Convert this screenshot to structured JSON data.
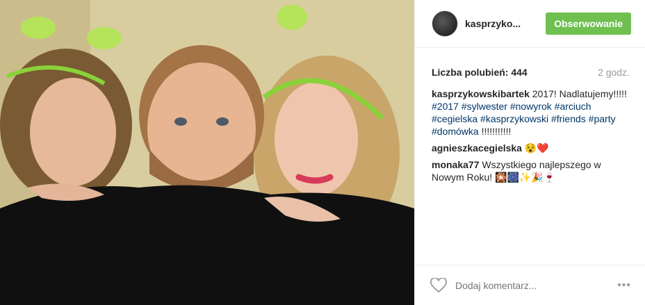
{
  "post": {
    "author": "kasprzyko...",
    "follow_label": "Obserwowanie",
    "likes_text": "Liczba polubień: 444",
    "time_ago": "2 godz.",
    "caption": {
      "user": "kasprzykowskibartek",
      "text": "2017! Nadlatujemy!!!!!",
      "tags": [
        "#2017",
        "#sylwester",
        "#nowyrok",
        "#arciuch",
        "#cegielska",
        "#kasprzykowski",
        "#friends",
        "#party",
        "#domówka"
      ],
      "trailing": "!!!!!!!!!!!"
    },
    "comments": [
      {
        "user": "agnieszkacegielska",
        "text": "😵❤️"
      },
      {
        "user": "monaka77",
        "text": "Wszystkiego najlepszego w Nowym Roku! 🎇🎆✨🎉🍷"
      }
    ],
    "add_comment_placeholder": "Dodaj komentarz...",
    "more_label": "•••"
  },
  "icons": {
    "like": "heart-outline-icon",
    "more": "more-options-icon"
  },
  "colors": {
    "follow_bg": "#70c050",
    "hashtag": "#003569",
    "muted": "#999999"
  }
}
